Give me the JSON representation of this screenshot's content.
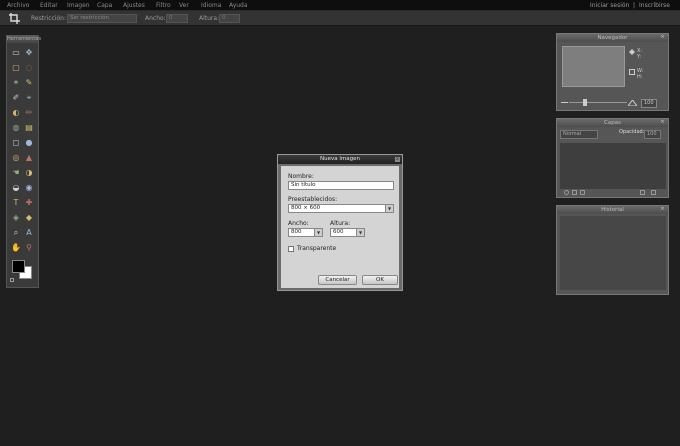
{
  "menubar": {
    "items": [
      "Archivo",
      "Editar",
      "Imagen",
      "Capa",
      "Ajustes",
      "Filtro",
      "Ver",
      "Idioma",
      "Ayuda"
    ],
    "right": {
      "login": "Iniciar sesión",
      "separator": "|",
      "register": "Inscribirse"
    }
  },
  "optionsbar": {
    "restriction_label": "Restricción:",
    "restriction_value": "Sin restricción",
    "width_label": "Ancho:",
    "width_value": "0",
    "height_label": "Altura:",
    "height_value": "0"
  },
  "tools": {
    "title": "Herramientas",
    "items": [
      "crop-icon",
      "move-icon",
      "marquee-icon",
      "lasso-icon",
      "wand-icon",
      "pencil-icon",
      "brush-icon",
      "clone-icon",
      "color-replace-icon",
      "draw-icon",
      "bucket-icon",
      "gradient-icon",
      "eraser-icon",
      "sponge-icon",
      "blur-icon",
      "sharpen-icon",
      "smudge-icon",
      "dodge-icon",
      "burn-icon",
      "redeye-icon",
      "text-icon",
      "spot-heal-icon",
      "bloat-icon",
      "pinch-icon",
      "eyedropper-icon",
      "type-icon",
      "hand-icon",
      "zoom-icon"
    ],
    "fg_color": "#000000",
    "bg_color": "#ffffff"
  },
  "navigator": {
    "title": "Navegador",
    "x_label": "X:",
    "y_label": "Y:",
    "w_label": "W:",
    "h_label": "H:",
    "zoom_value": "100"
  },
  "layers": {
    "title": "Capas",
    "blend_mode": "Normal",
    "opacity_label": "Opacidad:",
    "opacity_value": "100"
  },
  "history": {
    "title": "Historial"
  },
  "dialog": {
    "title": "Nueva imagen",
    "close": "x",
    "name_label": "Nombre:",
    "name_value": "Sin título",
    "preset_label": "Preestablecidos:",
    "preset_value": "800 × 600",
    "width_label": "Ancho:",
    "width_value": "800",
    "height_label": "Altura:",
    "height_value": "600",
    "transparent_label": "Transparente",
    "cancel": "Cancelar",
    "ok": "OK"
  },
  "colors": {
    "workspace": "#1f1f1f",
    "panel": "#565656",
    "dialog_body": "#d4d4d4"
  }
}
